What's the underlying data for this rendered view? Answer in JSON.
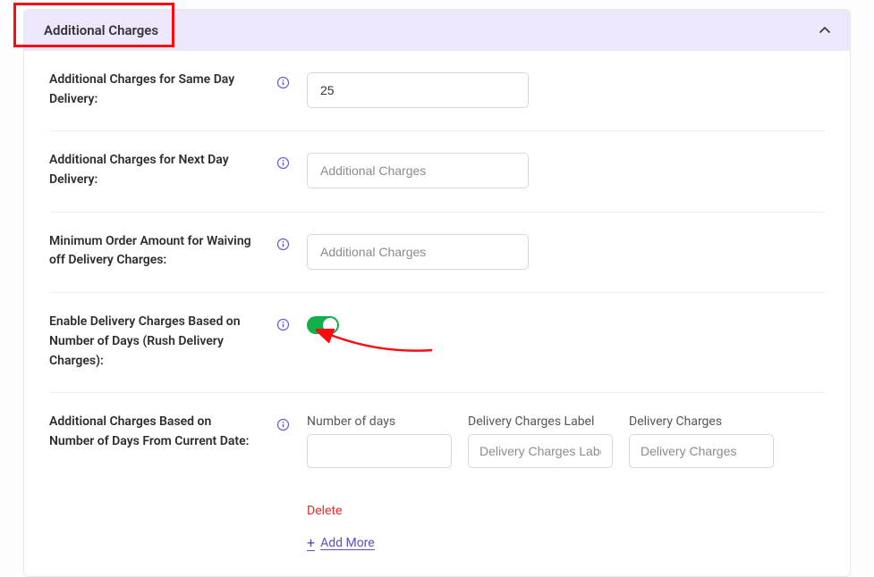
{
  "panel": {
    "title": "Additional Charges"
  },
  "rows": {
    "same_day": {
      "label": "Additional Charges for Same Day Delivery:",
      "value": "25"
    },
    "next_day": {
      "label": "Additional Charges for Next Day Delivery:",
      "placeholder": "Additional Charges"
    },
    "min_order": {
      "label": "Minimum Order Amount for Waiving off Delivery Charges:",
      "placeholder": "Additional Charges"
    },
    "enable_rush": {
      "label": "Enable Delivery Charges Based on Number of Days (Rush Delivery Charges):",
      "on": true
    },
    "by_days": {
      "label": "Additional Charges Based on Number of Days From Current Date:",
      "fields": {
        "num_days": "Number of days",
        "charges_label": "Delivery Charges Label",
        "charges_label_ph": "Delivery Charges Label",
        "charges": "Delivery Charges",
        "charges_ph": "Delivery Charges"
      },
      "delete": "Delete",
      "add_more": "Add More"
    }
  }
}
